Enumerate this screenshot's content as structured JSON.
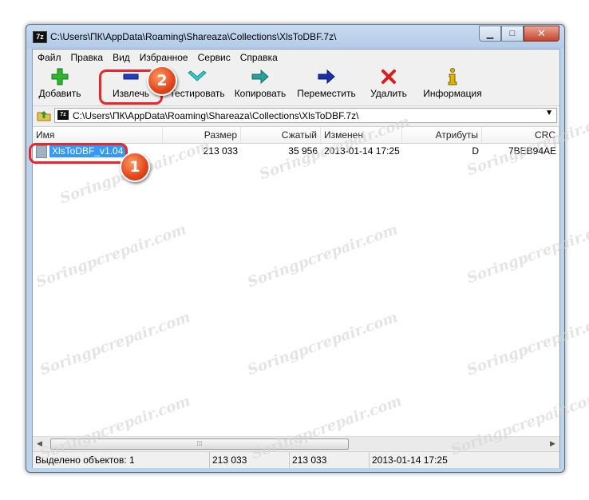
{
  "window": {
    "title": "C:\\Users\\ПК\\AppData\\Roaming\\Shareaza\\Collections\\XlsToDBF.7z\\",
    "app_icon_text": "7z",
    "minimize": "▁",
    "maximize": "□",
    "close": "✕"
  },
  "menu": [
    "Файл",
    "Правка",
    "Вид",
    "Избранное",
    "Сервис",
    "Справка"
  ],
  "toolbar": {
    "add": "Добавить",
    "extract": "Извлечь",
    "test": "Тестировать",
    "copy": "Копировать",
    "move": "Переместить",
    "delete": "Удалить",
    "info": "Информация"
  },
  "address": {
    "path": "C:\\Users\\ПК\\AppData\\Roaming\\Shareaza\\Collections\\XlsToDBF.7z\\"
  },
  "columns": {
    "name": "Имя",
    "size": "Размер",
    "packed": "Сжатый",
    "modified": "Изменен",
    "attributes": "Атрибуты",
    "crc": "CRC"
  },
  "rows": [
    {
      "name": "XlsToDBF_v1.04",
      "size": "213 033",
      "packed": "35 956",
      "modified": "2013-01-14 17:25",
      "attributes": "D",
      "crc": "7BEB94AE"
    }
  ],
  "status": {
    "selected": "Выделено объектов: 1",
    "size": "213 033",
    "packed": "213 033",
    "modified": "2013-01-14 17:25"
  },
  "annotations": {
    "badge1": "1",
    "badge2": "2"
  },
  "watermark": "Soringpcrepair.com",
  "colors": {
    "selection": "#3399ff",
    "callout": "#e8262b"
  }
}
